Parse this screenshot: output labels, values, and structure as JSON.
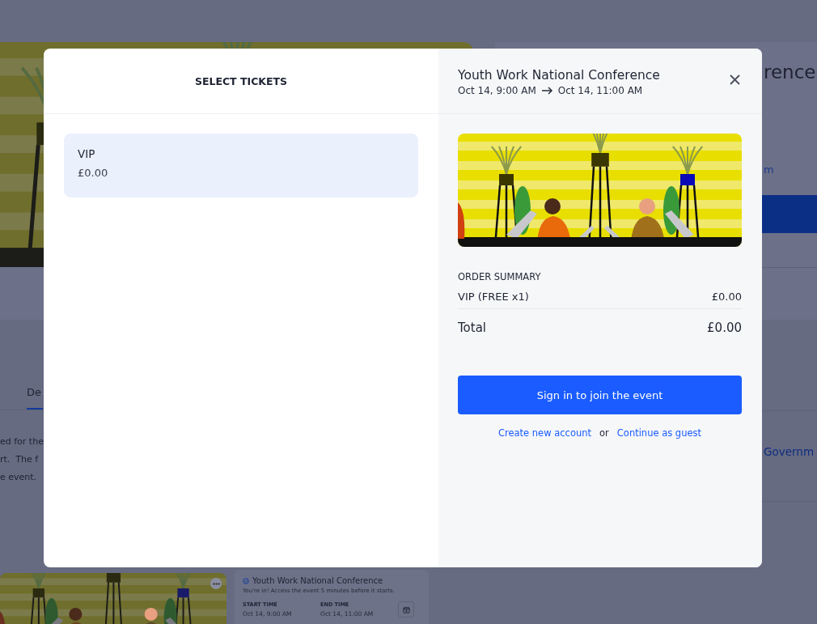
{
  "background_page": {
    "event_title": "rence",
    "link_text": "m",
    "tabs": [
      {
        "label": "De",
        "selected": true
      }
    ],
    "description_lines": [
      "ed for the",
      "rt.  The f",
      "e event."
    ],
    "organizer": "Governm",
    "event_card": {
      "title": "Youth Work National Conference",
      "subtitle": "You're in! Access the event 5 minutes before it starts.",
      "start_label": "START TIME",
      "start_value": "Oct 14, 9:00 AM",
      "end_label": "END TIME",
      "end_value": "Oct 14, 11:00 AM"
    }
  },
  "modal": {
    "left_title": "SELECT TICKETS",
    "tickets": [
      {
        "name": "VIP",
        "price": "£0.00",
        "selected": true
      }
    ],
    "event_title": "Youth Work National Conference",
    "start": "Oct 14, 9:00 AM",
    "end": "Oct 14, 11:00 AM",
    "order_summary": {
      "heading": "ORDER SUMMARY",
      "items": [
        {
          "label": "VIP (FREE x1)",
          "amount": "£0.00"
        }
      ],
      "total_label": "Total",
      "total_amount": "£0.00"
    },
    "primary_action": "Sign in to join the event",
    "links": [
      {
        "label": "Create new account"
      },
      {
        "label": "Continue as guest"
      }
    ],
    "separator": "or"
  }
}
